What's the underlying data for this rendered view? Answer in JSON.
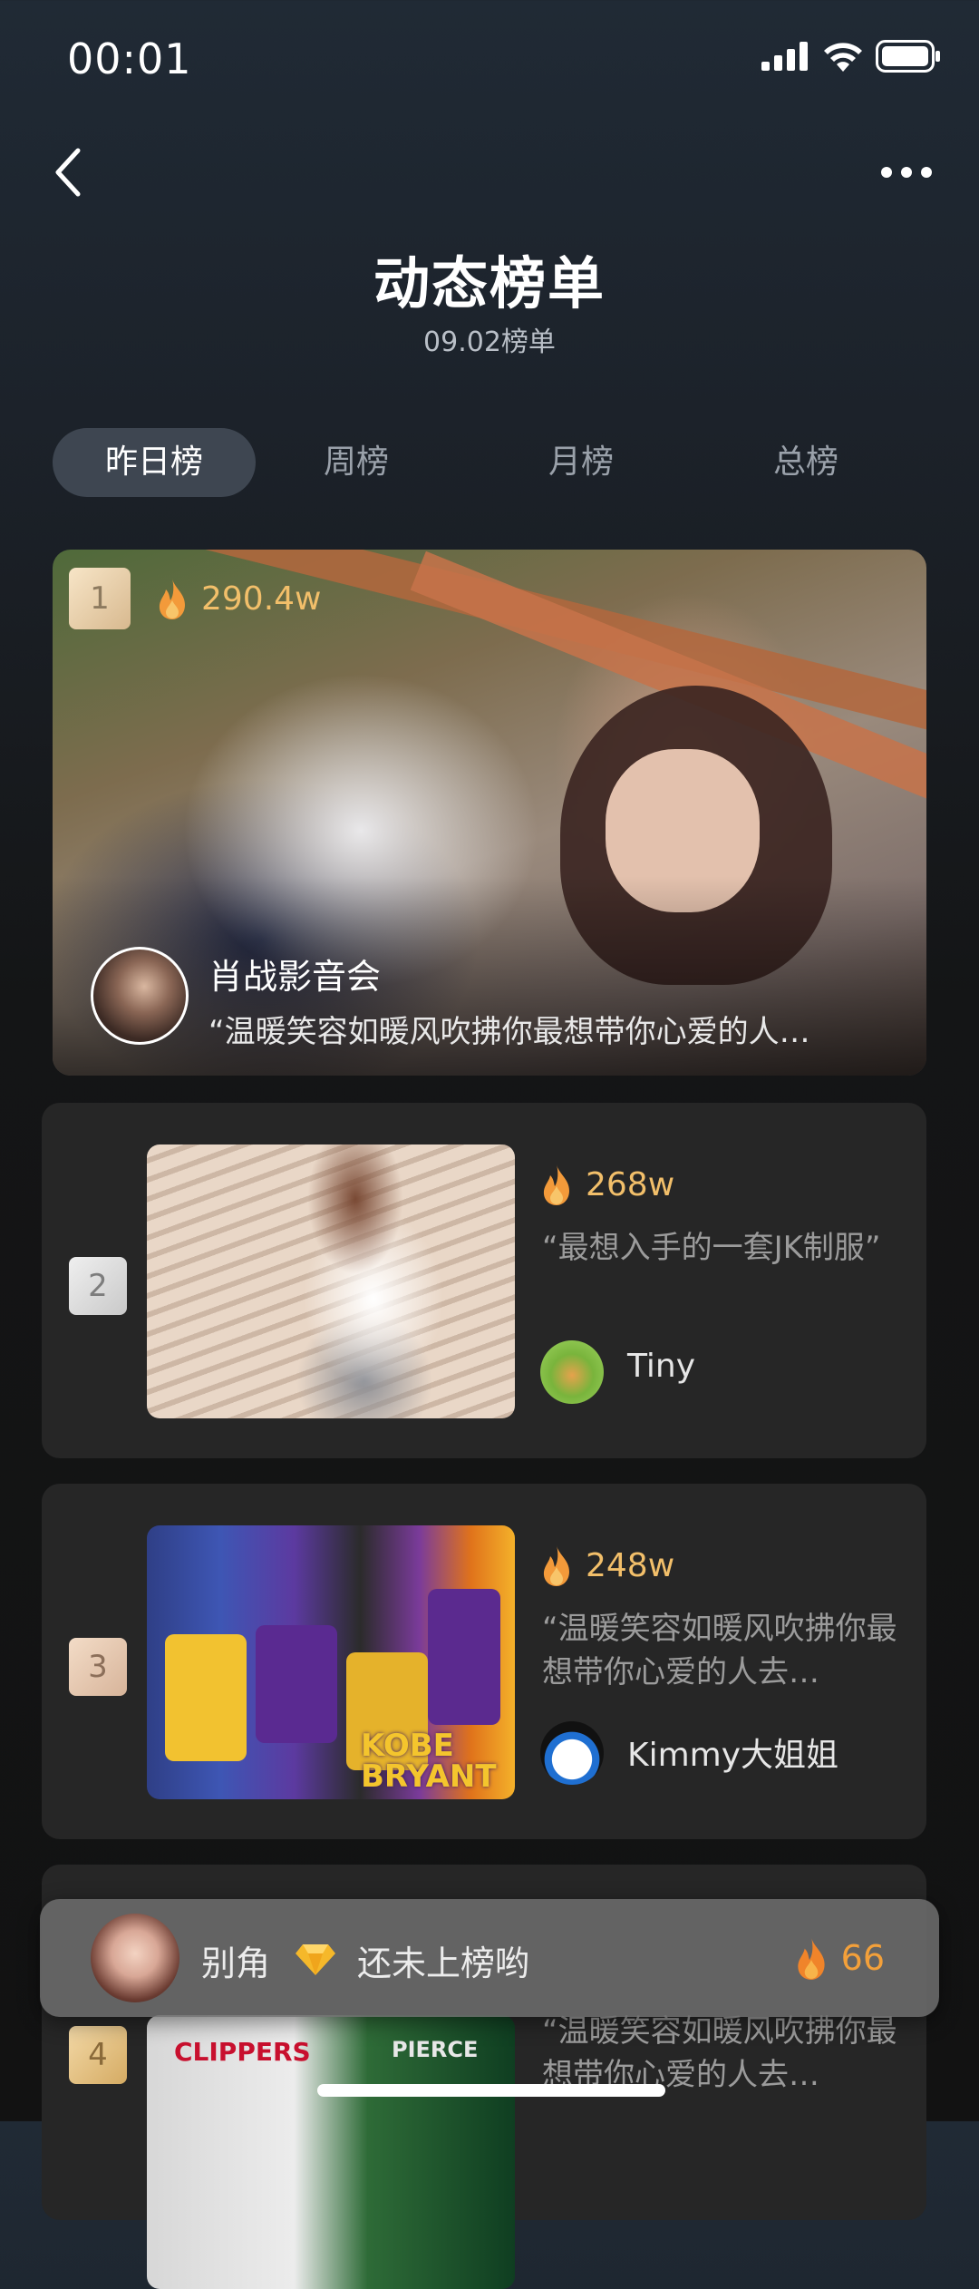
{
  "status_bar": {
    "time": "00:01"
  },
  "header": {
    "title": "动态榜单",
    "subtitle": "09.02榜单"
  },
  "tabs": [
    {
      "label": "昨日榜",
      "active": true
    },
    {
      "label": "周榜",
      "active": false
    },
    {
      "label": "月榜",
      "active": false
    },
    {
      "label": "总榜",
      "active": false
    }
  ],
  "featured": {
    "rank": "1",
    "heat": "290.4w",
    "author": "肖战影音会",
    "desc": "“温暖笑容如暖风吹拂你最想带你心爱的人…"
  },
  "items": [
    {
      "rank": "2",
      "heat": "268w",
      "desc": "“最想入手的一套JK制服”",
      "author": "Tiny"
    },
    {
      "rank": "3",
      "heat": "248w",
      "desc": "“温暖笑容如暖风吹拂你最想带你心爱的人去…",
      "author": "Kimmy大姐姐",
      "image_text": "KOBE BRYANT"
    },
    {
      "rank": "4",
      "desc": "“温暖笑容如暖风吹拂你最想带你心爱的人去…",
      "image_text_left": "CLIPPERS",
      "image_text_right": "PIERCE"
    }
  ],
  "my_rank": {
    "name": "别角",
    "status": "还未上榜哟",
    "heat": "66"
  },
  "colors": {
    "heat_text": "#f2bf6a",
    "flame": "#f39a3a",
    "active_tab_bg": "#3e4651",
    "card_bg": "#262626"
  }
}
